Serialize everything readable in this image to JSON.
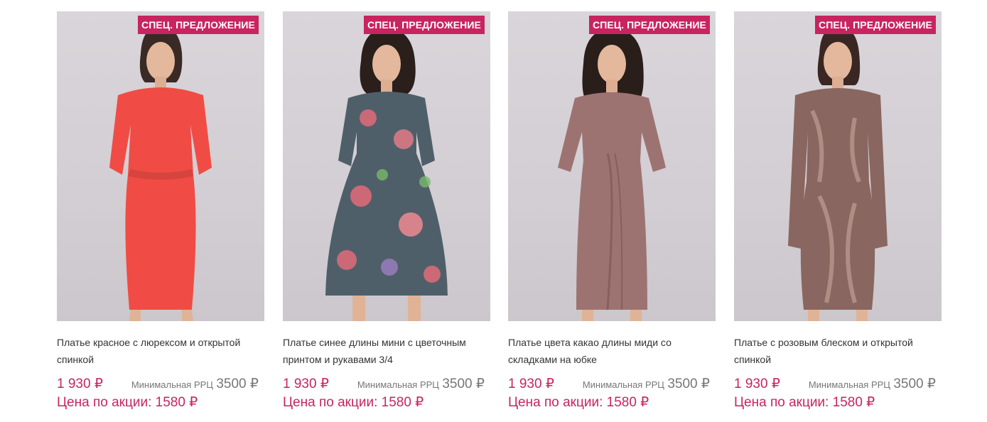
{
  "colors": {
    "accent": "#c8245f",
    "text": "#333333",
    "muted": "#777777"
  },
  "products": [
    {
      "badge": "СПЕЦ. ПРЕДЛОЖЕНИЕ",
      "title": "Платье красное с люрексом и открытой спинкой",
      "price": "1 930 ₽",
      "rrc_label": "Минимальная РРЦ",
      "rrc_value": "3500 ₽",
      "promo": "Цена по акции: 1580 ₽",
      "dress_color": "#f04c45",
      "image_name": "red-dress-photo"
    },
    {
      "badge": "СПЕЦ. ПРЕДЛОЖЕНИЕ",
      "title": "Платье синее длины мини с цветочным принтом и рукавами 3/4",
      "price": "1 930 ₽",
      "rrc_label": "Минимальная РРЦ",
      "rrc_value": "3500 ₽",
      "promo": "Цена по акции: 1580 ₽",
      "dress_color": "#4f5f6a",
      "image_name": "floral-dress-photo"
    },
    {
      "badge": "СПЕЦ. ПРЕДЛОЖЕНИЕ",
      "title": "Платье цвета какао длины миди со складками на юбке",
      "price": "1 930 ₽",
      "rrc_label": "Минимальная РРЦ",
      "rrc_value": "3500 ₽",
      "promo": "Цена по акции: 1580 ₽",
      "dress_color": "#9d7371",
      "image_name": "cocoa-dress-photo"
    },
    {
      "badge": "СПЕЦ. ПРЕДЛОЖЕНИЕ",
      "title": "Платье с розовым блеском и открытой спинкой",
      "price": "1 930 ₽",
      "rrc_label": "Минимальная РРЦ",
      "rrc_value": "3500 ₽",
      "promo": "Цена по акции: 1580 ₽",
      "dress_color": "#8a6660",
      "image_name": "metallic-dress-photo"
    }
  ]
}
